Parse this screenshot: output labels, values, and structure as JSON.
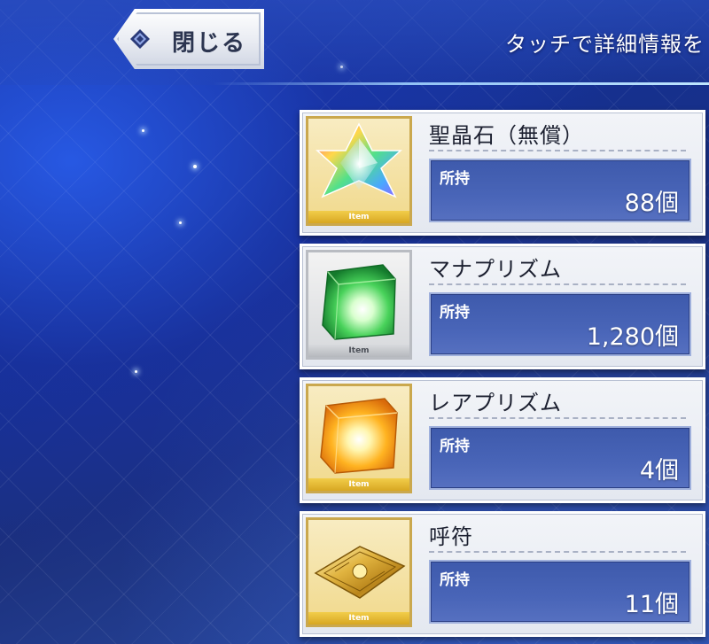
{
  "header": {
    "close_label": "閉じる",
    "hint": "タッチで詳細情報を"
  },
  "items": [
    {
      "name": "聖晶石（無償）",
      "owned_label": "所持",
      "count": "88個",
      "badge": "Item",
      "icon": "saint-quartz-icon",
      "frame": "gold"
    },
    {
      "name": "マナプリズム",
      "owned_label": "所持",
      "count": "1,280個",
      "badge": "Item",
      "icon": "mana-prism-icon",
      "frame": "silver"
    },
    {
      "name": "レアプリズム",
      "owned_label": "所持",
      "count": "4個",
      "badge": "Item",
      "icon": "rare-prism-icon",
      "frame": "gold"
    },
    {
      "name": "呼符",
      "owned_label": "所持",
      "count": "11個",
      "badge": "Item",
      "icon": "summon-ticket-icon",
      "frame": "gold"
    }
  ]
}
